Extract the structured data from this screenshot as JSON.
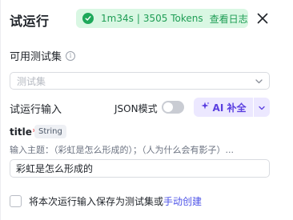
{
  "header": {
    "title": "试运行",
    "status": {
      "duration": "1m34s",
      "separator": "|",
      "tokens": "3505 Tokens",
      "view_log_label": "查看日志",
      "icon": "check-circle-icon",
      "color": "#1ea85a"
    },
    "close_icon": "close-icon"
  },
  "test_set": {
    "label": "可用测试集",
    "info_icon": "info-icon",
    "placeholder": "测试集",
    "chevron_icon": "chevron-down-icon"
  },
  "run_input": {
    "label": "试运行输入",
    "json_mode_label": "JSON模式",
    "json_mode_enabled": false,
    "ai_button_label": "AI 补全",
    "ai_icon": "sparkle-icon",
    "accent_color": "#5a3fe0"
  },
  "param": {
    "name": "title",
    "required_mark": "*",
    "type": "String",
    "description": "输入主题：（彩虹是怎么形成的）；（人为什么会有影子）...",
    "value": "彩虹是怎么形成的"
  },
  "footer": {
    "save_text": "将本次运行输入保存为测试集或",
    "manual_link": "手动创建",
    "checked": false,
    "link_color": "#4d53e8"
  }
}
